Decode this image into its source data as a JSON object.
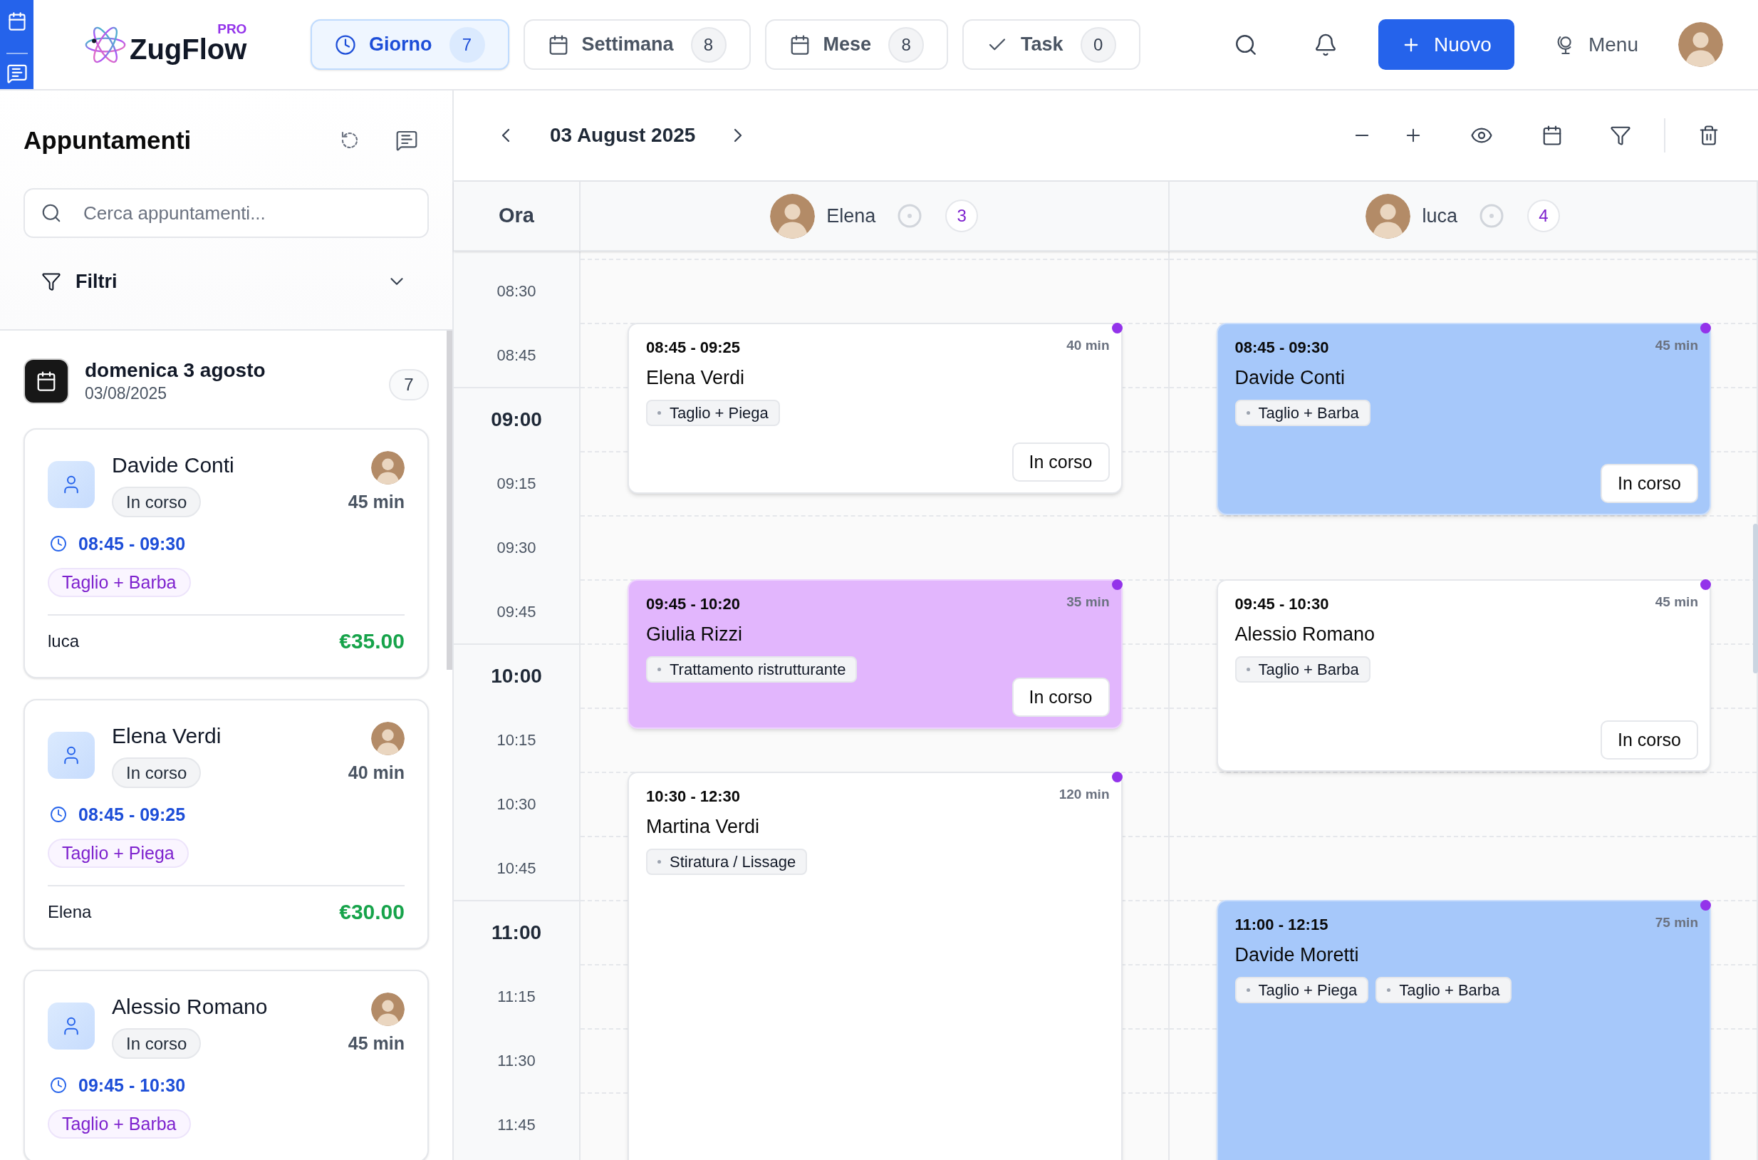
{
  "top_bar": {
    "logo": {
      "name": "ZugFlow",
      "badge": "PRO"
    },
    "view_tabs": [
      {
        "kind": "day",
        "label": "Giorno",
        "count": "7",
        "selected": true
      },
      {
        "kind": "week",
        "label": "Settimana",
        "count": "8",
        "selected": false
      },
      {
        "kind": "month",
        "label": "Mese",
        "count": "8",
        "selected": false
      },
      {
        "kind": "task",
        "label": "Task",
        "count": "0",
        "selected": false
      }
    ],
    "new_button": "Nuovo",
    "menu_button": "Menu"
  },
  "sidebar": {
    "title": "Appuntamenti",
    "search": {
      "placeholder": "Cerca appuntamenti..."
    },
    "filters": {
      "label": "Filtri",
      "expanded": false
    },
    "day": {
      "title": "domenica 3 agosto",
      "date": "03/08/2025",
      "count": "7"
    },
    "appointments": [
      {
        "client": "Davide Conti",
        "status": "In corso",
        "duration": "45 min",
        "time": "08:45 - 09:30",
        "service": "Taglio + Barba",
        "staff": "luca",
        "price": "€35.00"
      },
      {
        "client": "Elena Verdi",
        "status": "In corso",
        "duration": "40 min",
        "time": "08:45 - 09:25",
        "service": "Taglio + Piega",
        "staff": "Elena",
        "price": "€30.00"
      },
      {
        "client": "Alessio Romano",
        "status": "In corso",
        "duration": "45 min",
        "time": "09:45 - 10:30",
        "service": "Taglio + Barba"
      }
    ]
  },
  "calendar": {
    "date": "03 August 2025",
    "time_header": "Ora",
    "slots": [
      {
        "label": "08:30",
        "kind": "quarter"
      },
      {
        "label": "08:45",
        "kind": "quarter"
      },
      {
        "label": "09:00",
        "kind": "hour"
      },
      {
        "label": "09:15",
        "kind": "quarter"
      },
      {
        "label": "09:30",
        "kind": "quarter"
      },
      {
        "label": "09:45",
        "kind": "quarter"
      },
      {
        "label": "10:00",
        "kind": "hour"
      },
      {
        "label": "10:15",
        "kind": "quarter"
      },
      {
        "label": "10:30",
        "kind": "quarter"
      },
      {
        "label": "10:45",
        "kind": "quarter"
      },
      {
        "label": "11:00",
        "kind": "hour"
      },
      {
        "label": "11:15",
        "kind": "quarter"
      },
      {
        "label": "11:30",
        "kind": "quarter"
      },
      {
        "label": "11:45",
        "kind": "quarter"
      }
    ],
    "staff": [
      {
        "name": "Elena",
        "count": "3",
        "events": [
          {
            "time": "08:45 - 09:25",
            "duration": "40 min",
            "client": "Elena Verdi",
            "services": [
              "Taglio + Piega"
            ],
            "status": "In corso",
            "color": "#ffffff"
          },
          {
            "time": "09:45 - 10:20",
            "duration": "35 min",
            "client": "Giulia Rizzi",
            "services": [
              "Trattamento ristrutturante"
            ],
            "status": "In corso",
            "color": "#e2b6fd"
          },
          {
            "time": "10:30 - 12:30",
            "duration": "120 min",
            "client": "Martina Verdi",
            "services": [
              "Stiratura / Lissage"
            ],
            "color": "#ffffff"
          }
        ]
      },
      {
        "name": "luca",
        "count": "4",
        "events": [
          {
            "time": "08:45 - 09:30",
            "duration": "45 min",
            "client": "Davide Conti",
            "services": [
              "Taglio + Barba"
            ],
            "status": "In corso",
            "color": "#a6c8fa"
          },
          {
            "time": "09:45 - 10:30",
            "duration": "45 min",
            "client": "Alessio Romano",
            "services": [
              "Taglio + Barba"
            ],
            "status": "In corso",
            "color": "#ffffff"
          },
          {
            "time": "11:00 - 12:15",
            "duration": "75 min",
            "client": "Davide Moretti",
            "services": [
              "Taglio + Piega",
              "Taglio + Barba"
            ],
            "color": "#a6c8fa"
          }
        ]
      }
    ]
  }
}
